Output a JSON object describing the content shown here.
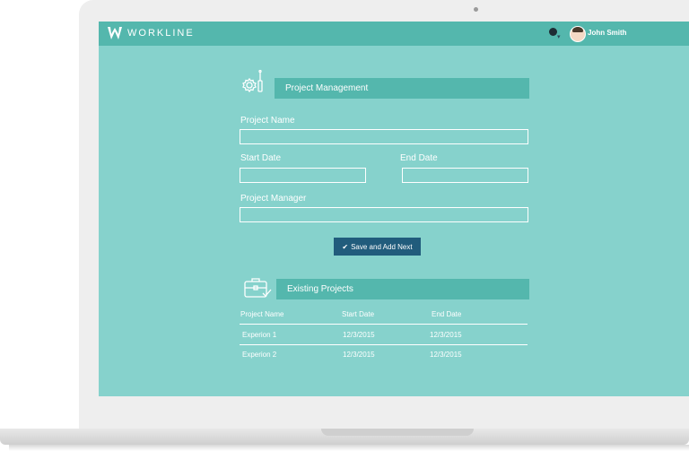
{
  "brand": {
    "name": "WORKLINE"
  },
  "header": {
    "user_name": "John Smith",
    "notification_icon": "bell-icon"
  },
  "form": {
    "title": "Project Management",
    "icon": "settings-gear-icon",
    "fields": {
      "project_name": {
        "label": "Project Name",
        "value": ""
      },
      "start_date": {
        "label": "Start Date",
        "value": ""
      },
      "end_date": {
        "label": "End Date",
        "value": ""
      },
      "project_manager": {
        "label": "Project Manager",
        "value": ""
      }
    },
    "submit_label": "Save and Add Next"
  },
  "projects": {
    "title": "Existing Projects",
    "icon": "briefcase-check-icon",
    "columns": [
      "Project Name",
      "Start Date",
      "End Date"
    ],
    "rows": [
      [
        "Experion 1",
        "12/3/2015",
        "12/3/2015"
      ],
      [
        "Experion 2",
        "12/3/2015",
        "12/3/2015"
      ]
    ]
  },
  "colors": {
    "screen_bg": "#86d2cc",
    "accent": "#54b7ad",
    "button": "#215c7c"
  }
}
